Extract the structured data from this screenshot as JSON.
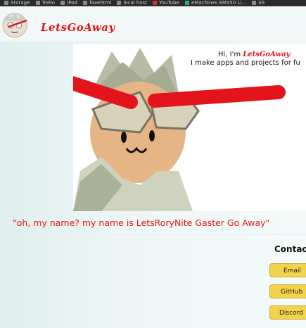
{
  "bookmarks": [
    {
      "label": "Storage",
      "icon": "folder-icon"
    },
    {
      "label": "Trello",
      "icon": "folder-icon"
    },
    {
      "label": "iPod",
      "icon": "folder-icon"
    },
    {
      "label": "faxehtml",
      "icon": "folder-icon"
    },
    {
      "label": "local host",
      "icon": "folder-icon"
    },
    {
      "label": "YouTube",
      "icon": "youtube-icon"
    },
    {
      "label": "eMachines EM350 Li...",
      "icon": "page-icon"
    },
    {
      "label": "SS",
      "icon": "page-icon"
    }
  ],
  "header": {
    "brand": "LetsGoAway"
  },
  "hero": {
    "greeting_prefix": "Hi, I'm ",
    "greeting_name": "LetsGoAway",
    "tagline": "I make apps and projects for fu"
  },
  "quote": "\"oh, my name? my name is LetsRoryNite Gaster Go Away\"",
  "contact": {
    "title": "Contac",
    "buttons": [
      {
        "label": "Email"
      },
      {
        "label": "GitHub"
      },
      {
        "label": "Discord"
      }
    ]
  },
  "colors": {
    "accent_red": "#e3141b",
    "button_yellow": "#f3d34a",
    "background": "#eef6f6"
  }
}
